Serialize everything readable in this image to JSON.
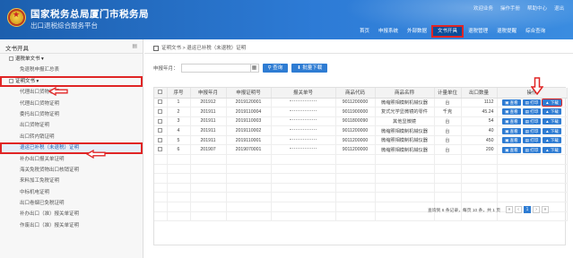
{
  "header": {
    "title": "国家税务总局厦门市税务局",
    "subtitle": "出口退税综合服务平台",
    "top_links": [
      "欢迎业务",
      "操作手册",
      "帮助中心",
      "退出"
    ],
    "nav": [
      {
        "label": "首页",
        "active": false
      },
      {
        "label": "申报系统",
        "active": false
      },
      {
        "label": "外部数据",
        "active": false
      },
      {
        "label": "文书开具",
        "active": true
      },
      {
        "label": "退税管理",
        "active": false
      },
      {
        "label": "退税提醒",
        "active": false
      },
      {
        "label": "综合查询",
        "active": false
      }
    ]
  },
  "sidebar": {
    "title": "文书开具",
    "items": [
      {
        "label": "退税单文书",
        "type": "group",
        "boxed": false
      },
      {
        "label": "免退税申报汇总表",
        "type": "sub",
        "boxed": false
      },
      {
        "label": "证明文书",
        "type": "group",
        "boxed": true
      },
      {
        "label": "代理出口货物证明",
        "type": "sub",
        "boxed": false
      },
      {
        "label": "代理出口货物证明",
        "type": "sub",
        "boxed": false
      },
      {
        "label": "委托出口货物证明",
        "type": "sub",
        "boxed": false
      },
      {
        "label": "出口货物证明",
        "type": "sub",
        "boxed": false
      },
      {
        "label": "出口转内销证明",
        "type": "sub",
        "boxed": false
      },
      {
        "label": "退运已补税（未退税）证明",
        "type": "sub",
        "boxed": true,
        "selected": true
      },
      {
        "label": "补办出口报关单证明",
        "type": "sub",
        "boxed": false
      },
      {
        "label": "海关免税货物出口核销证明",
        "type": "sub",
        "boxed": false
      },
      {
        "label": "来料加工免税证明",
        "type": "sub",
        "boxed": false
      },
      {
        "label": "中标机电证明",
        "type": "sub",
        "boxed": false
      },
      {
        "label": "出口卷烟已免税证明",
        "type": "sub",
        "boxed": false
      },
      {
        "label": "补办出口（准）报关单证明",
        "type": "sub",
        "boxed": false
      },
      {
        "label": "作废出口（准）报关单证明",
        "type": "sub",
        "boxed": false
      }
    ]
  },
  "breadcrumb": "证明文书 > 退运已补税（未退税）证明",
  "filter": {
    "label": "申报年月：",
    "placeholder": "",
    "query_button": "查询",
    "download_button": "批量下载"
  },
  "table": {
    "headers": [
      "",
      "序号",
      "申报年月",
      "申报证明号",
      "报关单号",
      "商品代码",
      "商品名称",
      "计量单位",
      "出口数量",
      "操作"
    ],
    "rows": [
      {
        "seq": "1",
        "month": "201912",
        "cert": "2019120001",
        "code": "9011200000",
        "name": "微缩照相模制机械仪器",
        "unit": "台",
        "qty": "1112"
      },
      {
        "seq": "2",
        "month": "201911",
        "cert": "2019110004",
        "code": "9011900000",
        "name": "复式光学显微镜的零件",
        "unit": "千克",
        "qty": "45.24"
      },
      {
        "seq": "3",
        "month": "201911",
        "cert": "2019110003",
        "code": "9011800090",
        "name": "其他显微镜",
        "unit": "台",
        "qty": "54"
      },
      {
        "seq": "4",
        "month": "201911",
        "cert": "2019110002",
        "code": "9011200000",
        "name": "微缩照相模制机械仪器",
        "unit": "台",
        "qty": "40"
      },
      {
        "seq": "5",
        "month": "201911",
        "cert": "2019110001",
        "code": "9011200000",
        "name": "微缩照相模制机械仪器",
        "unit": "台",
        "qty": "450"
      },
      {
        "seq": "6",
        "month": "201907",
        "cert": "2019070001",
        "code": "9011200000",
        "name": "微缩照相模制机械仪器",
        "unit": "台",
        "qty": "200"
      }
    ],
    "ops": [
      "查看",
      "打印",
      "下载"
    ],
    "empty_rows": 7
  },
  "pager": {
    "info": "查询到 6 条记录，每页 10 条，共 1 页",
    "buttons": [
      "«",
      "‹",
      "1",
      "›",
      "»"
    ],
    "current": "1"
  },
  "colors": {
    "header_blue": "#1c5fae",
    "accent_blue": "#2e7cd3",
    "highlight_red": "#e02525"
  }
}
